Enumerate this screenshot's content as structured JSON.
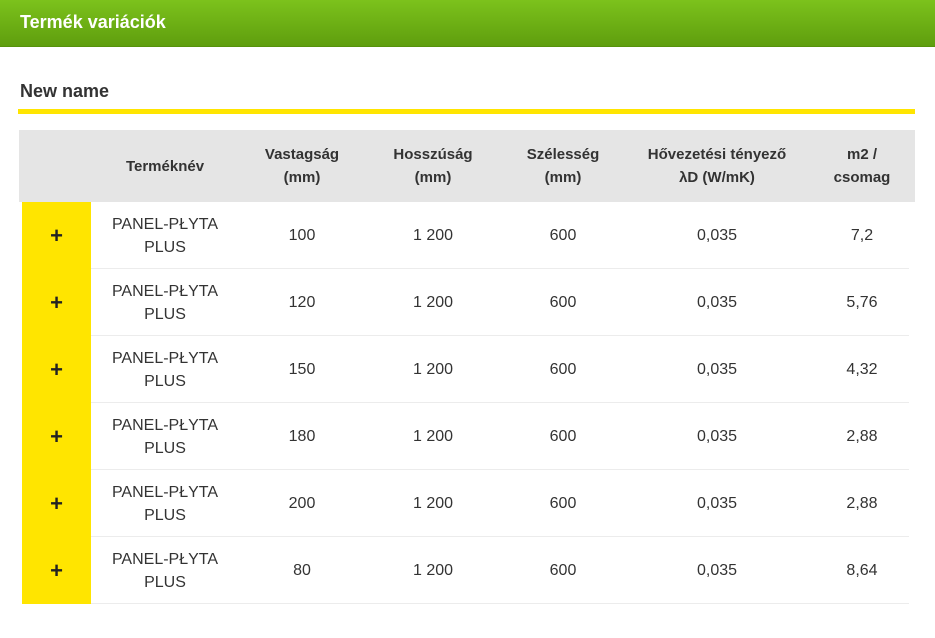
{
  "header": {
    "title": "Termék variációk"
  },
  "section": {
    "title": "New name"
  },
  "table": {
    "columns": [
      "",
      "Terméknév",
      "Vastagság\n(mm)",
      "Hosszúság\n(mm)",
      "Szélesség\n(mm)",
      "Hővezetési tényező\nλD (W/mK)",
      "m2 /\ncsomag"
    ],
    "rows": [
      {
        "expand": "+",
        "name": "PANEL-PŁYTA PLUS",
        "thickness": "100",
        "length": "1 200",
        "width": "600",
        "lambda": "0,035",
        "m2": "7,2"
      },
      {
        "expand": "+",
        "name": "PANEL-PŁYTA PLUS",
        "thickness": "120",
        "length": "1 200",
        "width": "600",
        "lambda": "0,035",
        "m2": "5,76"
      },
      {
        "expand": "+",
        "name": "PANEL-PŁYTA PLUS",
        "thickness": "150",
        "length": "1 200",
        "width": "600",
        "lambda": "0,035",
        "m2": "4,32"
      },
      {
        "expand": "+",
        "name": "PANEL-PŁYTA PLUS",
        "thickness": "180",
        "length": "1 200",
        "width": "600",
        "lambda": "0,035",
        "m2": "2,88"
      },
      {
        "expand": "+",
        "name": "PANEL-PŁYTA PLUS",
        "thickness": "200",
        "length": "1 200",
        "width": "600",
        "lambda": "0,035",
        "m2": "2,88"
      },
      {
        "expand": "+",
        "name": "PANEL-PŁYTA PLUS",
        "thickness": "80",
        "length": "1 200",
        "width": "600",
        "lambda": "0,035",
        "m2": "8,64"
      }
    ]
  },
  "colors": {
    "header_green": "#6fb016",
    "accent_yellow": "#ffe500",
    "table_header_bg": "#e5e5e5"
  }
}
